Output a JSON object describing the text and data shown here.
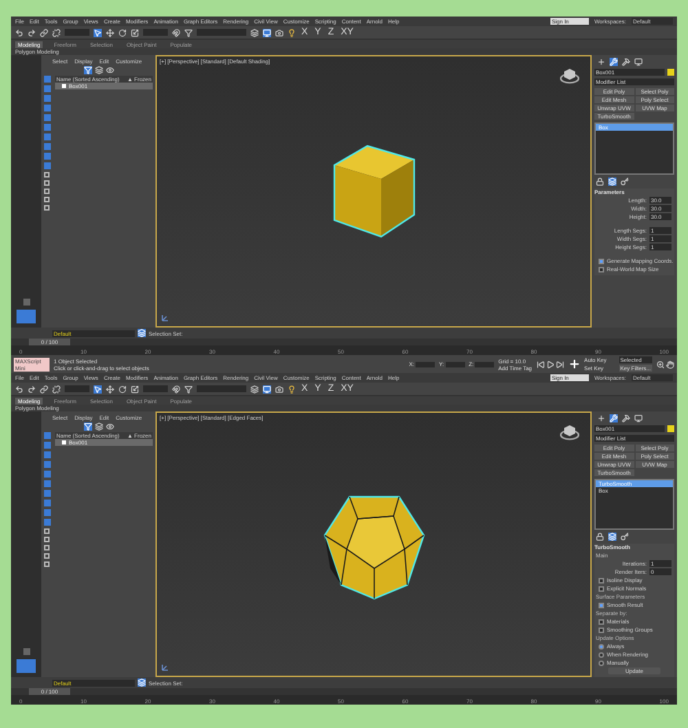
{
  "windows": [
    {
      "menu": [
        "File",
        "Edit",
        "Tools",
        "Group",
        "Views",
        "Create",
        "Modifiers",
        "Animation",
        "Graph Editors",
        "Rendering",
        "Civil View",
        "Customize",
        "Scripting",
        "Content",
        "Arnold",
        "Help"
      ],
      "sign_in": "Sign In",
      "workspaces_label": "Workspaces:",
      "workspace": "Default",
      "axis_buttons": [
        "X",
        "Y",
        "Z",
        "XY"
      ],
      "ribbon_tabs": [
        {
          "label": "Modeling",
          "selected": true
        },
        {
          "label": "Freeform",
          "selected": false
        },
        {
          "label": "Selection",
          "selected": false
        },
        {
          "label": "Object Paint",
          "selected": false
        },
        {
          "label": "Populate",
          "selected": false
        }
      ],
      "ribbon_panel": "Polygon Modeling",
      "explorer": {
        "tabs": [
          "Select",
          "Display",
          "Edit",
          "Customize"
        ],
        "columns": [
          "Name (Sorted Ascending)",
          "▲ Frozen"
        ],
        "rows": [
          {
            "name": "Box001",
            "selected": true
          }
        ]
      },
      "viewport": {
        "label": "[+] [Perspective] [Standard] [Default Shading]",
        "object": {
          "kind": "box"
        }
      },
      "command": {
        "name": "Box001",
        "color": "#e6d21a",
        "modifier_list": "Modifier List",
        "buttons": [
          "Edit Poly",
          "Select Poly",
          "Edit Mesh",
          "Poly Select",
          "Unwrap UVW",
          "UVW Map",
          "TurboSmooth"
        ],
        "stack": [
          {
            "label": "Box",
            "selected": true
          }
        ],
        "rollout": {
          "title": "Parameters",
          "rows": [
            {
              "kind": "spinner",
              "label": "Length:",
              "value": "30.0"
            },
            {
              "kind": "spinner",
              "label": "Width:",
              "value": "30.0"
            },
            {
              "kind": "spinner",
              "label": "Height:",
              "value": "30.0"
            },
            {
              "kind": "gap"
            },
            {
              "kind": "spinner",
              "label": "Length Segs:",
              "value": "1"
            },
            {
              "kind": "spinner",
              "label": "Width Segs:",
              "value": "1"
            },
            {
              "kind": "spinner",
              "label": "Height Segs:",
              "value": "1"
            },
            {
              "kind": "gap"
            },
            {
              "kind": "check",
              "label": "Generate Mapping Coords.",
              "checked": true
            },
            {
              "kind": "check",
              "label": "Real-World Map Size",
              "checked": false
            }
          ]
        }
      },
      "layer": "Default",
      "selection_set": "Selection Set:",
      "time_slider": {
        "label": "0 / 100",
        "level": 0
      },
      "ticks": [
        "0",
        "10",
        "20",
        "30",
        "40",
        "50",
        "60",
        "70",
        "80",
        "90",
        "100"
      ],
      "status": {
        "listener": "MAXScript Mini",
        "selected": "1 Object Selected",
        "prompt": "Click or click-and-drag to select objects",
        "coords": [
          "X:",
          "Y:",
          "Z:"
        ],
        "grid": "Grid = 10.0",
        "time_tag": "Add Time Tag",
        "auto_key": "Auto Key",
        "auto_value": "Selected",
        "set_key": "Set Key",
        "key_filters": "Key Filters..."
      }
    },
    {
      "menu": [
        "File",
        "Edit",
        "Tools",
        "Group",
        "Views",
        "Create",
        "Modifiers",
        "Animation",
        "Graph Editors",
        "Rendering",
        "Civil View",
        "Customize",
        "Scripting",
        "Content",
        "Arnold",
        "Help"
      ],
      "sign_in": "Sign In",
      "workspaces_label": "Workspaces:",
      "workspace": "Default",
      "axis_buttons": [
        "X",
        "Y",
        "Z",
        "XY"
      ],
      "ribbon_tabs": [
        {
          "label": "Modeling",
          "selected": true
        },
        {
          "label": "Freeform",
          "selected": false
        },
        {
          "label": "Selection",
          "selected": false
        },
        {
          "label": "Object Paint",
          "selected": false
        },
        {
          "label": "Populate",
          "selected": false
        }
      ],
      "ribbon_panel": "Polygon Modeling",
      "explorer": {
        "tabs": [
          "Select",
          "Display",
          "Edit",
          "Customize"
        ],
        "columns": [
          "Name (Sorted Ascending)",
          "▲ Frozen"
        ],
        "rows": [
          {
            "name": "Box001",
            "selected": true
          }
        ]
      },
      "viewport": {
        "label": "[+] [Perspective] [Standard] [Edged Faces]",
        "object": {
          "kind": "smooth"
        }
      },
      "command": {
        "name": "Box001",
        "color": "#e6d21a",
        "modifier_list": "Modifier List",
        "buttons": [
          "Edit Poly",
          "Select Poly",
          "Edit Mesh",
          "Poly Select",
          "Unwrap UVW",
          "UVW Map",
          "TurboSmooth"
        ],
        "stack": [
          {
            "label": "TurboSmooth",
            "selected": true
          },
          {
            "label": "Box",
            "selected": false
          }
        ],
        "rollout": {
          "title": "TurboSmooth",
          "rows": [
            {
              "kind": "heading",
              "label": "Main"
            },
            {
              "kind": "spinner",
              "label": "Iterations:",
              "value": "1"
            },
            {
              "kind": "spinner",
              "label": "Render Iters:",
              "value": "0"
            },
            {
              "kind": "check",
              "label": "Isoline Display",
              "checked": false
            },
            {
              "kind": "check",
              "label": "Explicit Normals",
              "checked": false
            },
            {
              "kind": "heading",
              "label": "Surface Parameters"
            },
            {
              "kind": "check",
              "label": "Smooth Result",
              "checked": true
            },
            {
              "kind": "heading",
              "label": "Separate by:"
            },
            {
              "kind": "check",
              "label": "Materials",
              "checked": false
            },
            {
              "kind": "check",
              "label": "Smoothing Groups",
              "checked": false
            },
            {
              "kind": "heading",
              "label": "Update Options"
            },
            {
              "kind": "radio",
              "label": "Always",
              "checked": true
            },
            {
              "kind": "radio",
              "label": "When Rendering",
              "checked": false
            },
            {
              "kind": "radio",
              "label": "Manually",
              "checked": false
            },
            {
              "kind": "button",
              "label": "Update"
            }
          ]
        }
      },
      "layer": "Default",
      "selection_set": "Selection Set:",
      "time_slider": {
        "label": "0 / 100",
        "level": 0
      },
      "ticks": [
        "0",
        "10",
        "20",
        "30",
        "40",
        "50",
        "60",
        "70",
        "80",
        "90",
        "100"
      ]
    }
  ]
}
